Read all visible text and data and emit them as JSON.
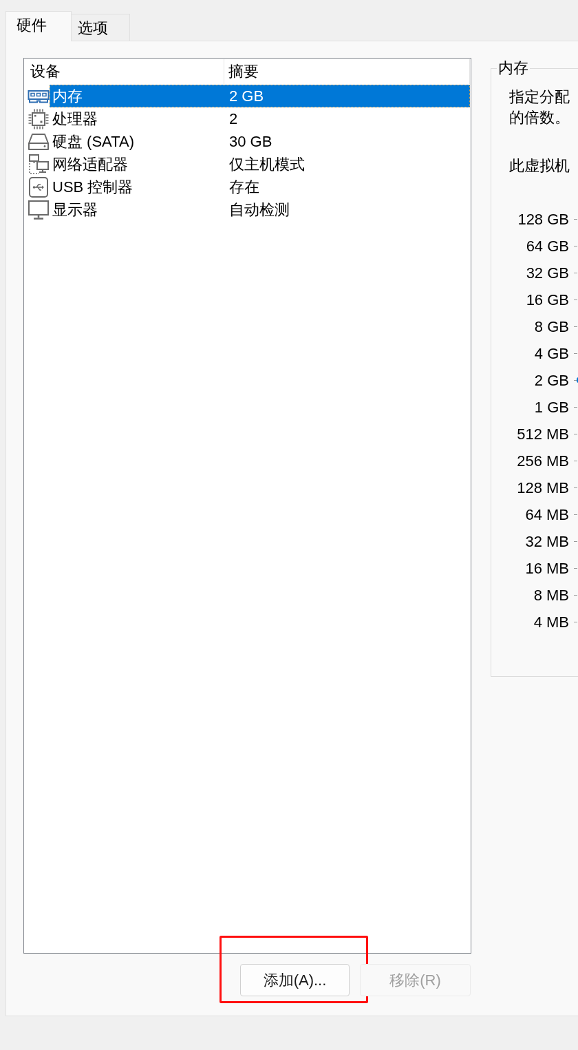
{
  "tabs": [
    {
      "label": "硬件",
      "selected": true
    },
    {
      "label": "选项",
      "selected": false
    }
  ],
  "device_list": {
    "columns": [
      "设备",
      "摘要"
    ],
    "rows": [
      {
        "kind": "memory",
        "name": "内存",
        "summary": "2 GB",
        "selected": true
      },
      {
        "kind": "processor",
        "name": "处理器",
        "summary": "2",
        "selected": false
      },
      {
        "kind": "disk",
        "name": "硬盘 (SATA)",
        "summary": "30 GB",
        "selected": false
      },
      {
        "kind": "network",
        "name": "网络适配器",
        "summary": "仅主机模式",
        "selected": false
      },
      {
        "kind": "usb",
        "name": "USB 控制器",
        "summary": "存在",
        "selected": false
      },
      {
        "kind": "display",
        "name": "显示器",
        "summary": "自动检测",
        "selected": false
      }
    ]
  },
  "buttons": [
    {
      "label": "添加(A)...",
      "disabled": false,
      "highlighted": true
    },
    {
      "label": "移除(R)",
      "disabled": true,
      "highlighted": false
    }
  ],
  "memory": {
    "title": "内存",
    "description": [
      "指定分配",
      "的倍数。"
    ],
    "note": "此虚拟机",
    "scale": [
      "128 GB",
      "64 GB",
      "32 GB",
      "16 GB",
      "8 GB",
      "4 GB",
      "2 GB",
      "1 GB",
      "512 MB",
      "256 MB",
      "128 MB",
      "64 MB",
      "32 MB",
      "16 MB",
      "8 MB",
      "4 MB"
    ],
    "slider": {
      "level": 0.6
    }
  }
}
